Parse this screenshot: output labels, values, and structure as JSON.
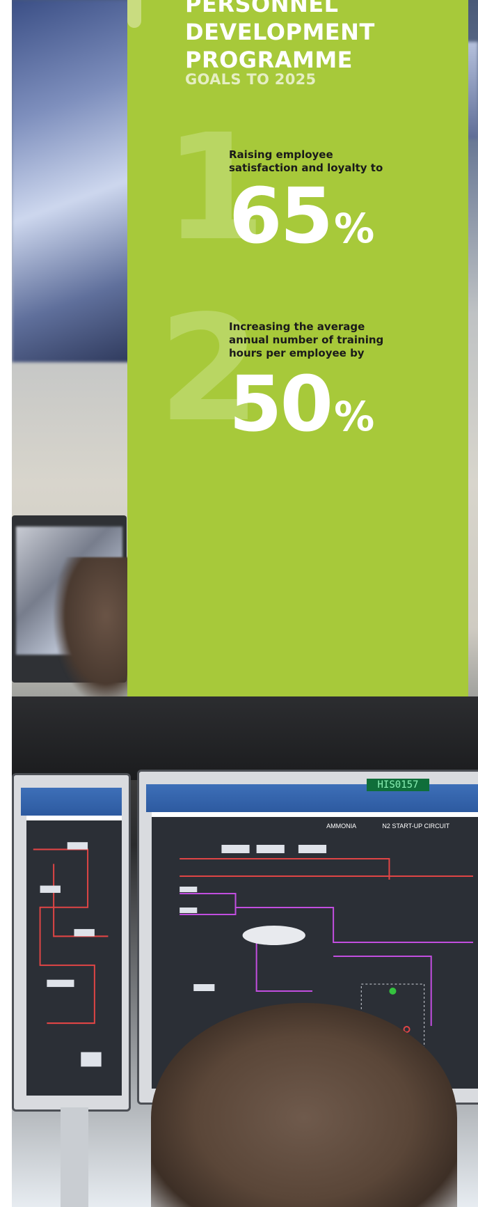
{
  "card": {
    "heading_lines": [
      "PERSONNEL",
      "DEVELOPMENT",
      "PROGRAMME"
    ],
    "subheading": "GOALS TO 2025"
  },
  "goals": [
    {
      "index": "1",
      "text": "Raising employee satisfaction and loyalty to",
      "value": "65",
      "unit": "%"
    },
    {
      "index": "2",
      "text": "Increasing the average annual number of training hours per employee by",
      "value": "50",
      "unit": "%"
    }
  ],
  "photo": {
    "monitor_tag": "HIS0157",
    "screen_labels": [
      "AMMONIA",
      "N2 START-UP CIRCUIT"
    ]
  },
  "colors": {
    "card_green": "#a7c93a",
    "digit_green": "#b9d663",
    "text_white": "#ffffff"
  }
}
